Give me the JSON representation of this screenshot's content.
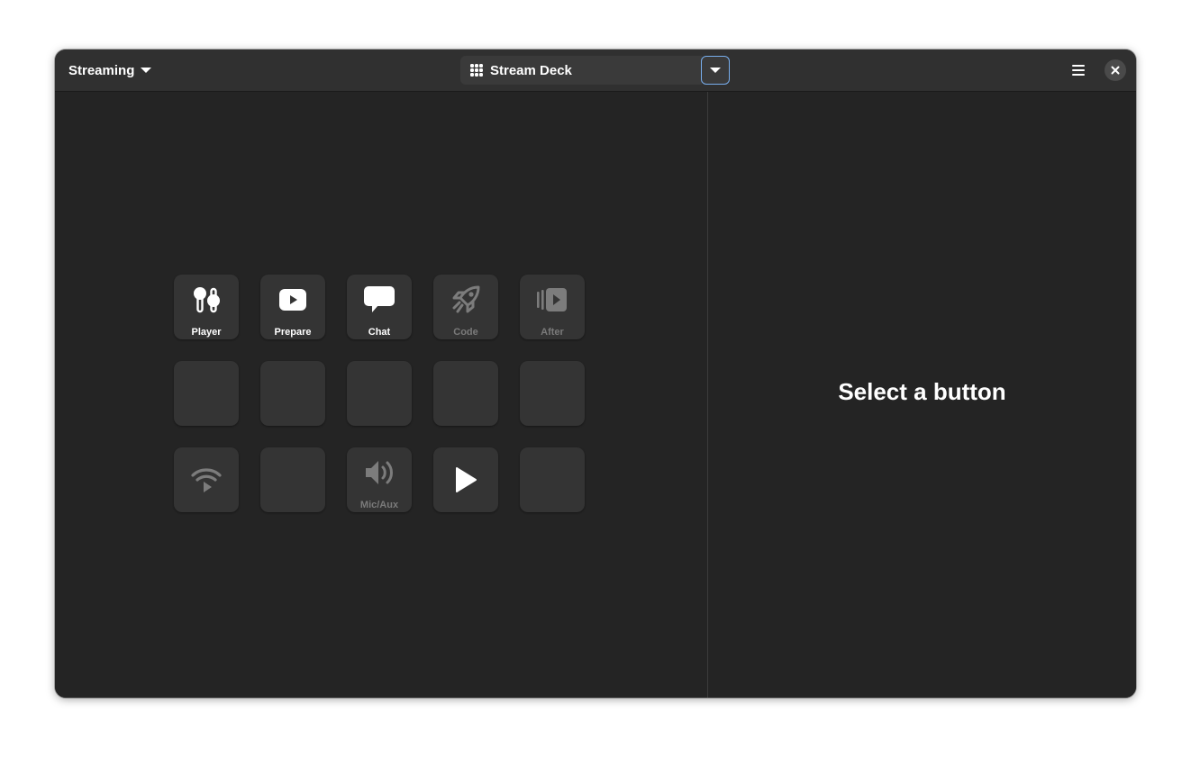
{
  "header": {
    "profile_label": "Streaming",
    "deck_label": "Stream Deck",
    "accent": "#78aeed"
  },
  "details": {
    "placeholder": "Select a button"
  },
  "keys": [
    {
      "label": "Player",
      "icon": "earbuds-icon",
      "dim": false
    },
    {
      "label": "Prepare",
      "icon": "youtube-icon",
      "dim": false
    },
    {
      "label": "Chat",
      "icon": "chat-bubble-icon",
      "dim": false
    },
    {
      "label": "Code",
      "icon": "rocket-icon",
      "dim": true
    },
    {
      "label": "After",
      "icon": "video-playlist-icon",
      "dim": true
    },
    {
      "label": "",
      "icon": "",
      "dim": false
    },
    {
      "label": "",
      "icon": "",
      "dim": false
    },
    {
      "label": "",
      "icon": "",
      "dim": false
    },
    {
      "label": "",
      "icon": "",
      "dim": false
    },
    {
      "label": "",
      "icon": "",
      "dim": false
    },
    {
      "label": "",
      "icon": "wifi-play-icon",
      "dim": true
    },
    {
      "label": "",
      "icon": "",
      "dim": false
    },
    {
      "label": "Mic/Aux",
      "icon": "speaker-icon",
      "dim": true
    },
    {
      "label": "",
      "icon": "play-icon",
      "dim": false
    },
    {
      "label": "",
      "icon": "",
      "dim": false
    }
  ]
}
